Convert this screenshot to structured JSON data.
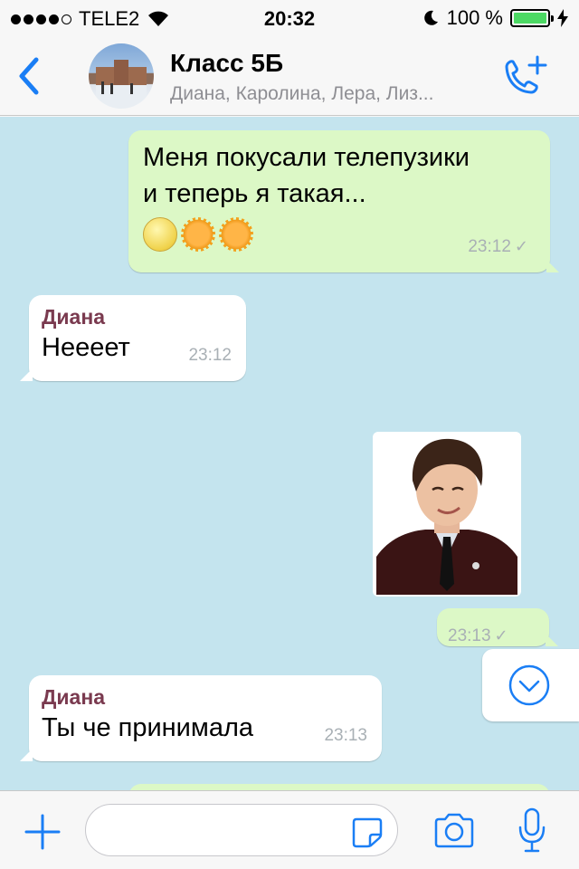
{
  "status_bar": {
    "carrier": "TELE2",
    "time": "20:32",
    "battery_percent": "100 %",
    "signal_bars_filled": 4,
    "signal_bars_total": 5,
    "battery_level": 1.0
  },
  "header": {
    "title": "Класс 5Б",
    "participants": "Диана, Каролина, Лера, Лиз..."
  },
  "messages": [
    {
      "direction": "out",
      "text_line1": "Меня покусали телепузики",
      "text_line2": "и теперь я такая...",
      "emojis": [
        "moon-face-emoji",
        "sun-face-emoji",
        "sun-face-emoji"
      ],
      "time": "23:12",
      "status": "sent"
    },
    {
      "direction": "in",
      "sender": "Диана",
      "text": "Нееeет",
      "time": "23:12"
    },
    {
      "direction": "out",
      "type": "sticker",
      "time": "23:13",
      "status": "sent"
    },
    {
      "direction": "in",
      "sender": "Диана",
      "text": "Ты че принимала",
      "time": "23:13"
    }
  ],
  "input": {
    "placeholder": "",
    "value": ""
  },
  "colors": {
    "accent": "#1a7ef5",
    "chat_background": "#c4e4ee",
    "outgoing_bubble": "#dcf8c6",
    "incoming_bubble": "#ffffff",
    "sender_name": "#7a3a4f",
    "battery_fill": "#4cd964"
  },
  "icons": {
    "back": "chevron-left-icon",
    "call": "add-call-icon",
    "scroll_down": "chevron-down-circle-icon",
    "attach": "plus-icon",
    "sticker": "sticker-icon",
    "camera": "camera-icon",
    "mic": "microphone-icon"
  }
}
